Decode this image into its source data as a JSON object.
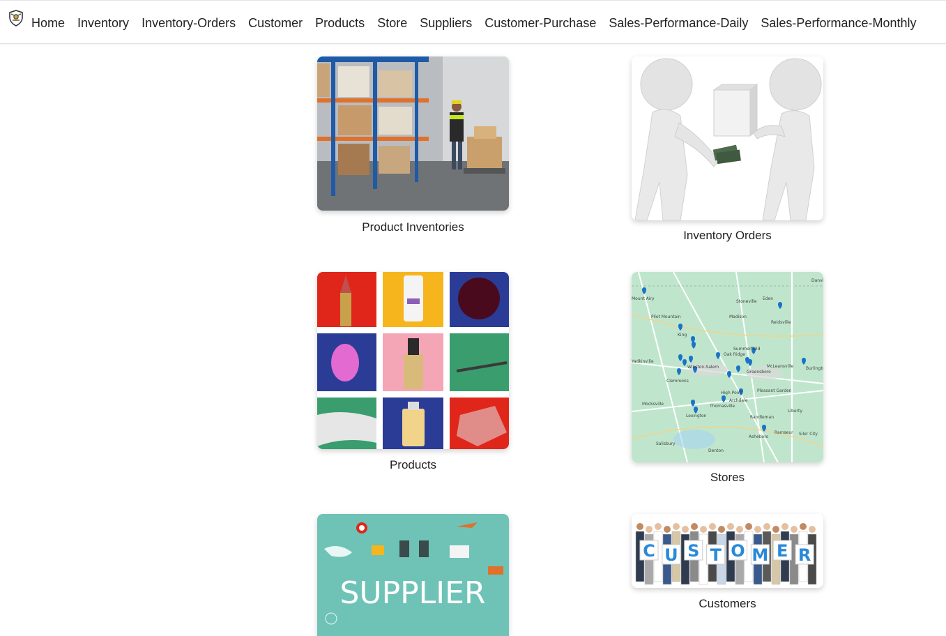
{
  "nav": {
    "logo": "shield-logo-icon",
    "items": [
      {
        "label": "Home"
      },
      {
        "label": "Inventory"
      },
      {
        "label": "Inventory-Orders"
      },
      {
        "label": "Customer"
      },
      {
        "label": "Products"
      },
      {
        "label": "Store"
      },
      {
        "label": "Suppliers"
      },
      {
        "label": "Customer-Purchase"
      },
      {
        "label": "Sales-Performance-Daily"
      },
      {
        "label": "Sales-Performance-Monthly"
      }
    ]
  },
  "cards": [
    {
      "caption": "Product Inventories",
      "image": "warehouse-worker-image"
    },
    {
      "caption": "Inventory Orders",
      "image": "figures-exchanging-box-image"
    },
    {
      "caption": "Products",
      "image": "cosmetics-grid-image"
    },
    {
      "caption": "Stores",
      "image": "store-locations-map-image"
    },
    {
      "caption": "",
      "image": "supplier-banner-image",
      "image_text": "SUPPLIER"
    },
    {
      "caption": "Customers",
      "image": "customer-group-image",
      "image_text": "CUSTOMER"
    }
  ],
  "map_labels": [
    "Winston-Salem",
    "Greensboro",
    "High Point",
    "Clemmons",
    "Lexington",
    "Thomasville",
    "Archdale",
    "Asheboro",
    "Randleman",
    "Reidsville",
    "Eden",
    "Stoneville",
    "Madison",
    "Pilot Mountain",
    "Mount Airy",
    "King",
    "Summerfield",
    "Oak Ridge",
    "McLeansville",
    "Burlington",
    "Pleasant Garden",
    "Liberty",
    "Mocksville",
    "Salisbury",
    "Denton",
    "Siler City",
    "Ramseur",
    "Yadkinville",
    "Danville"
  ]
}
